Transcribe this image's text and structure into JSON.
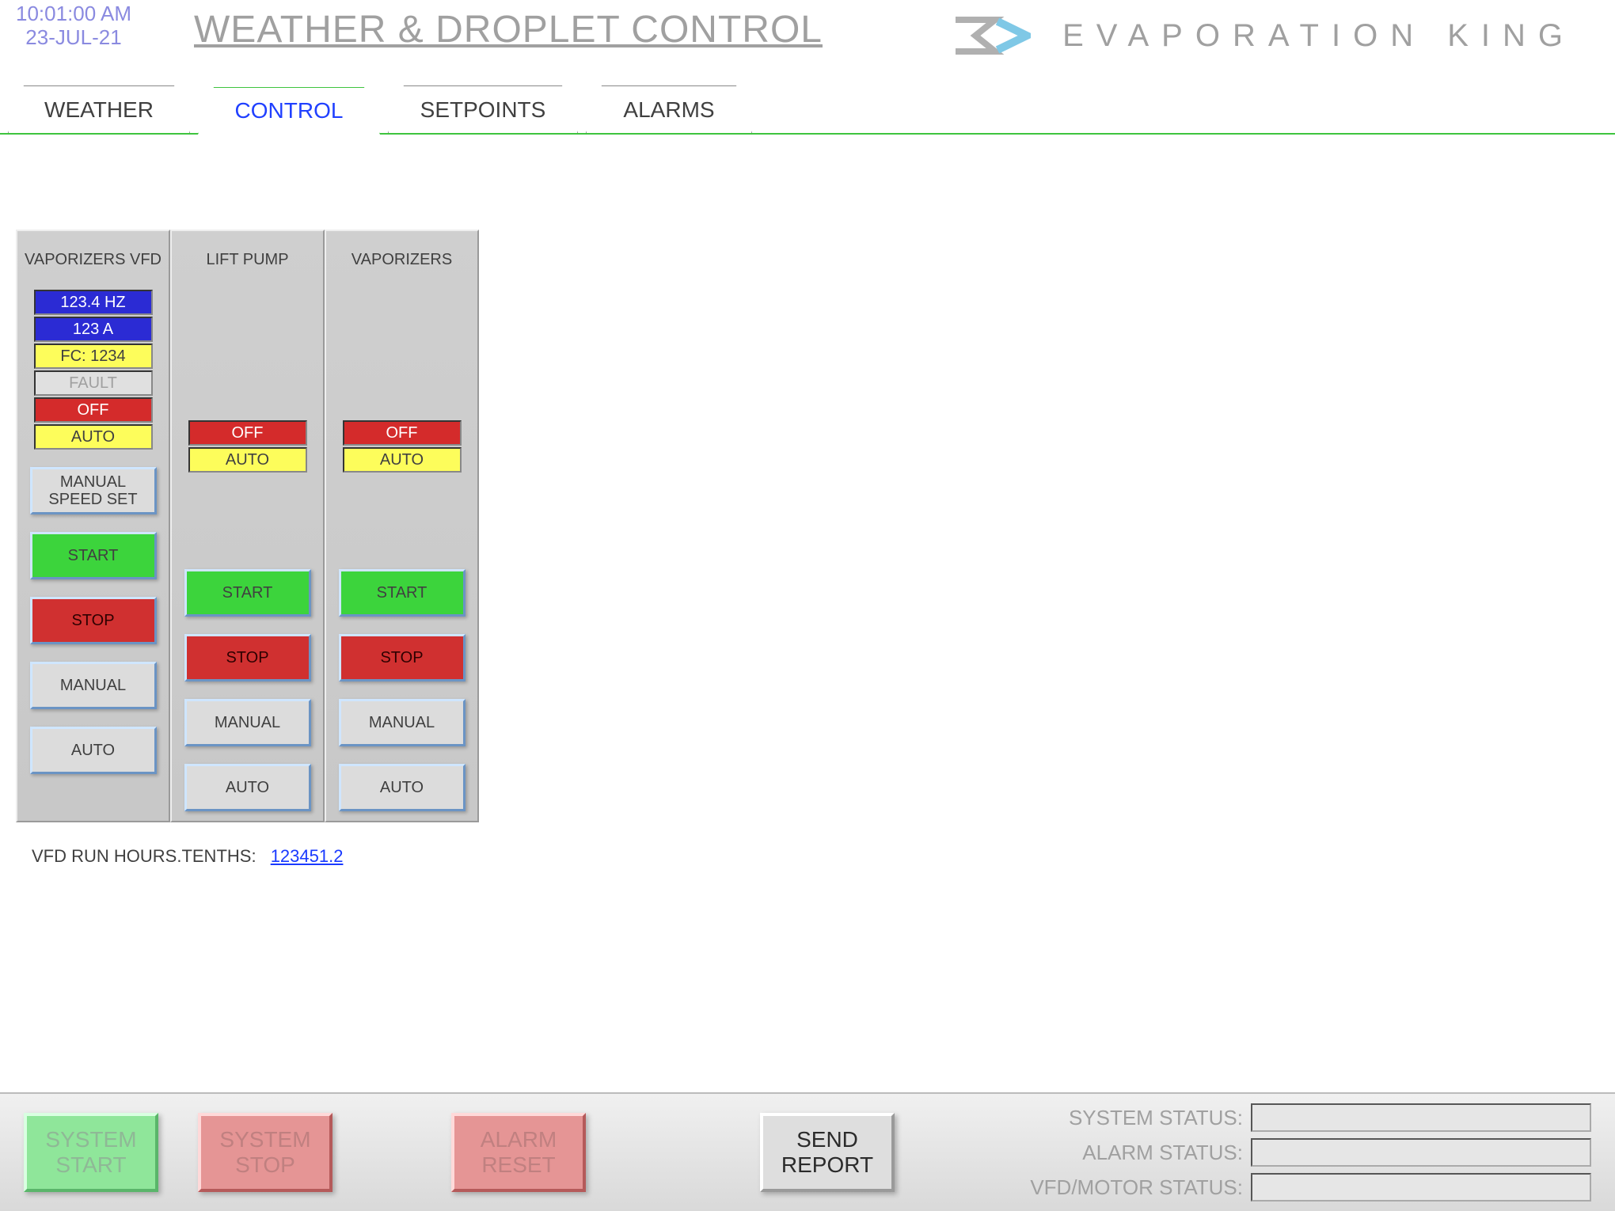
{
  "header": {
    "time": "10:01:00 AM",
    "date": "23-JUL-21",
    "title": "WEATHER & DROPLET CONTROL",
    "brand_name": "EVAPORATION KING"
  },
  "tabs": {
    "weather": "WEATHER",
    "control": "CONTROL",
    "setpoints": "SETPOINTS",
    "alarms": "ALARMS",
    "active": "control"
  },
  "panels": {
    "vfd": {
      "title": "VAPORIZERS VFD",
      "hz": "123.4 HZ",
      "amps": "123 A",
      "fc": "FC: 1234",
      "fault": "FAULT",
      "state": "OFF",
      "mode": "AUTO",
      "manual_speed": "MANUAL SPEED SET",
      "start": "START",
      "stop": "STOP",
      "manual": "MANUAL",
      "auto": "AUTO"
    },
    "lift": {
      "title": "LIFT PUMP",
      "state": "OFF",
      "mode": "AUTO",
      "start": "START",
      "stop": "STOP",
      "manual": "MANUAL",
      "auto": "AUTO"
    },
    "vap": {
      "title": "VAPORIZERS",
      "state": "OFF",
      "mode": "AUTO",
      "start": "START",
      "stop": "STOP",
      "manual": "MANUAL",
      "auto": "AUTO"
    }
  },
  "runhours": {
    "label": "VFD RUN HOURS.TENTHS:",
    "value": "123451.2"
  },
  "footer": {
    "system_start": "SYSTEM START",
    "system_stop": "SYSTEM STOP",
    "alarm_reset": "ALARM RESET",
    "send_report": "SEND REPORT",
    "status": {
      "system_label": "SYSTEM STATUS:",
      "alarm_label": "ALARM STATUS:",
      "vfd_label": "VFD/MOTOR STATUS:",
      "system_value": "",
      "alarm_value": "",
      "vfd_value": ""
    }
  }
}
